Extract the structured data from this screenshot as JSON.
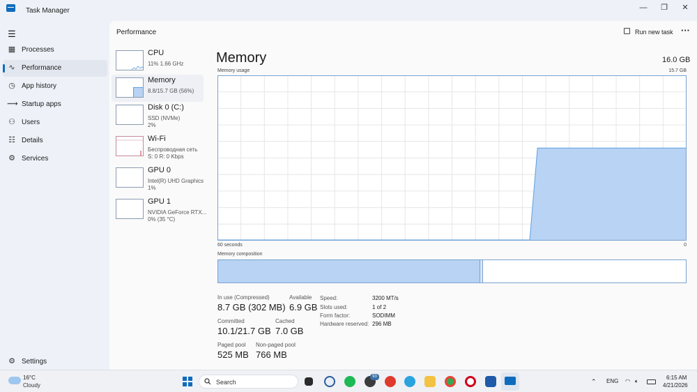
{
  "app": {
    "title": "Task Manager"
  },
  "window_controls": {
    "minimize": "—",
    "restore": "❐",
    "close": "✕"
  },
  "nav": {
    "items": [
      {
        "label": "Processes",
        "icon": "processes-icon"
      },
      {
        "label": "Performance",
        "icon": "performance-icon",
        "active": true
      },
      {
        "label": "App history",
        "icon": "history-icon"
      },
      {
        "label": "Startup apps",
        "icon": "startup-icon"
      },
      {
        "label": "Users",
        "icon": "users-icon"
      },
      {
        "label": "Details",
        "icon": "details-icon"
      },
      {
        "label": "Services",
        "icon": "services-icon"
      }
    ],
    "settings": "Settings"
  },
  "header": {
    "title": "Performance",
    "run_new_task": "Run new task",
    "more": "···"
  },
  "devices": [
    {
      "name": "CPU",
      "sub": [
        "11%  1.66 GHz"
      ]
    },
    {
      "name": "Memory",
      "sub": [
        "8.8/15.7 GB (56%)"
      ],
      "active": true
    },
    {
      "name": "Disk 0 (C:)",
      "sub": [
        "SSD (NVMe)",
        "2%"
      ]
    },
    {
      "name": "Wi-Fi",
      "sub": [
        "Беспроводная сеть",
        "S: 0  R: 0 Kbps"
      ]
    },
    {
      "name": "GPU 0",
      "sub": [
        "Intel(R) UHD Graphics",
        "1%"
      ]
    },
    {
      "name": "GPU 1",
      "sub": [
        "NVIDIA GeForce RTX...",
        "0%  (35 °C)"
      ]
    }
  ],
  "memory": {
    "title": "Memory",
    "capacity": "16.0 GB",
    "usage_label": "Memory usage",
    "max_label": "15.7 GB",
    "x_left_label": "60 seconds",
    "x_right_label": "0",
    "composition_label": "Memory composition",
    "composition": {
      "in_use_fraction": 0.56,
      "modified_fraction": 0.006
    },
    "stats": {
      "in_use_label": "In use (Compressed)",
      "in_use_value": "8.7 GB (302 MB)",
      "available_label": "Available",
      "available_value": "6.9 GB",
      "committed_label": "Committed",
      "committed_value": "10.1/21.7 GB",
      "cached_label": "Cached",
      "cached_value": "7.0 GB",
      "paged_label": "Paged pool",
      "paged_value": "525 MB",
      "nonpaged_label": "Non-paged pool",
      "nonpaged_value": "766 MB"
    },
    "specs": [
      {
        "label": "Speed:",
        "value": "3200 MT/s"
      },
      {
        "label": "Slots used:",
        "value": "1 of 2"
      },
      {
        "label": "Form factor:",
        "value": "SODIMM"
      },
      {
        "label": "Hardware reserved:",
        "value": "296 MB"
      }
    ],
    "graph_colors": {
      "line": "#5f9fe0",
      "fill": "#b8d3f4",
      "grid": "#e6e6e6"
    }
  },
  "chart_data": {
    "type": "area",
    "ylabel": "Memory usage",
    "xlabel": "60 seconds",
    "ylim": [
      0,
      15.7
    ],
    "x": [
      60,
      58,
      56,
      54,
      52,
      50,
      48,
      46,
      44,
      42,
      40,
      38,
      36,
      34,
      32,
      30,
      28,
      26,
      24,
      22,
      20,
      19,
      18,
      16,
      14,
      12,
      10,
      8,
      6,
      4,
      2,
      0
    ],
    "values": [
      0,
      0,
      0,
      0,
      0,
      0,
      0,
      0,
      0,
      0,
      0,
      0,
      0,
      0,
      0,
      0,
      0,
      0,
      0,
      0,
      0,
      8.8,
      8.8,
      8.8,
      8.8,
      8.8,
      8.8,
      8.8,
      8.8,
      8.8,
      8.8,
      8.8
    ]
  },
  "taskbar": {
    "weather_temp": "16°C",
    "weather_cond": "Cloudy",
    "search": "Search",
    "telegram_badge": "93",
    "language": "ENG",
    "time": "6:15 AM",
    "date": "4/21/2026"
  }
}
